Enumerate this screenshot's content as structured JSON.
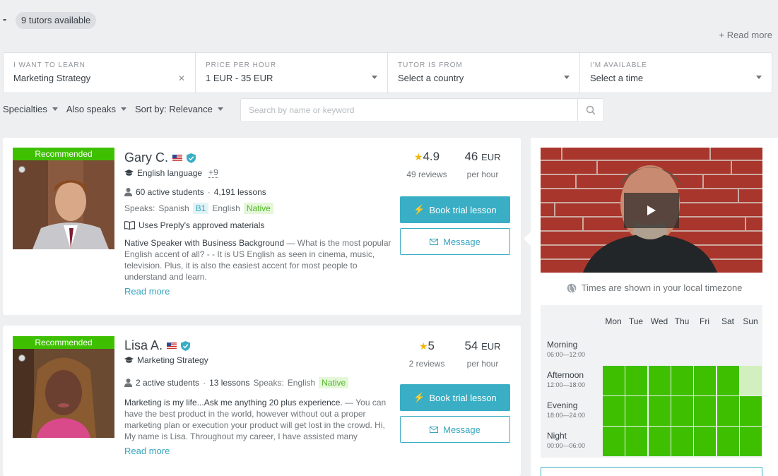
{
  "header": {
    "tutor_count": "9 tutors available",
    "read_more": "+ Read more"
  },
  "filters": {
    "learn": {
      "label": "I WANT TO LEARN",
      "value": "Marketing Strategy"
    },
    "price": {
      "label": "PRICE PER HOUR",
      "value": "1 EUR - 35 EUR"
    },
    "country": {
      "label": "TUTOR IS FROM",
      "value": "Select a country"
    },
    "available": {
      "label": "I'M AVAILABLE",
      "value": "Select a time"
    }
  },
  "sub_filters": {
    "specialties": "Specialties",
    "also_speaks": "Also speaks",
    "sort": "Sort by: Relevance",
    "search_placeholder": "Search by name or keyword"
  },
  "tutors": [
    {
      "recommended": "Recommended",
      "name": "Gary C.",
      "subject": "English language",
      "more_subjects": "+9",
      "students": "60 active students",
      "lessons": "4,191 lessons",
      "speaks_label": "Speaks:",
      "lang1": "Spanish",
      "lang1_level": "B1",
      "lang2": "English",
      "lang2_level": "Native",
      "materials": "Uses Preply's approved materials",
      "headline": "Native Speaker with Business Background",
      "description": " — What is the most popular English accent of all? - - It is US English as seen in cinema, music, television. Plus, it is also the easiest accent for most people to understand and learn.",
      "read_more": "Read more",
      "rating": "4.9",
      "reviews": "49 reviews",
      "price": "46",
      "currency": "EUR",
      "per_hour": "per hour",
      "book": "Book trial lesson",
      "message": "Message"
    },
    {
      "recommended": "Recommended",
      "name": "Lisa A.",
      "subject": "Marketing Strategy",
      "students": "2 active students",
      "lessons": "13 lessons",
      "speaks_label": "Speaks:",
      "lang1": "English",
      "lang1_level": "Native",
      "headline": "Marketing is my life...Ask me anything 20 plus experience.",
      "description": " — You can have the best product in the world, however without out a proper marketing plan or execution your product will get lost in the crowd. Hi, My name is Lisa. Throughout my career, I have assisted many",
      "read_more": "Read more",
      "rating": "5",
      "reviews": "2 reviews",
      "price": "54",
      "currency": "EUR",
      "per_hour": "per hour",
      "book": "Book trial lesson",
      "message": "Message"
    }
  ],
  "schedule": {
    "timezone_note": "Times are shown in your local timezone",
    "days": [
      "Mon",
      "Tue",
      "Wed",
      "Thu",
      "Fri",
      "Sat",
      "Sun"
    ],
    "slots": [
      {
        "name": "Morning",
        "range": "06:00—12:00"
      },
      {
        "name": "Afternoon",
        "range": "12:00—18:00"
      },
      {
        "name": "Evening",
        "range": "18:00—24:00"
      },
      {
        "name": "Night",
        "range": "00:00—06:00"
      }
    ],
    "availability": [
      [
        0,
        0,
        0,
        0,
        0,
        0,
        0
      ],
      [
        1,
        1,
        1,
        1,
        1,
        1,
        0.5
      ],
      [
        1,
        1,
        1,
        1,
        1,
        1,
        1
      ],
      [
        1,
        1,
        1,
        1,
        1,
        1,
        1
      ]
    ]
  },
  "colors": {
    "accent": "#3aaec4",
    "green": "#3ec000",
    "light_green": "#d1efbf"
  }
}
